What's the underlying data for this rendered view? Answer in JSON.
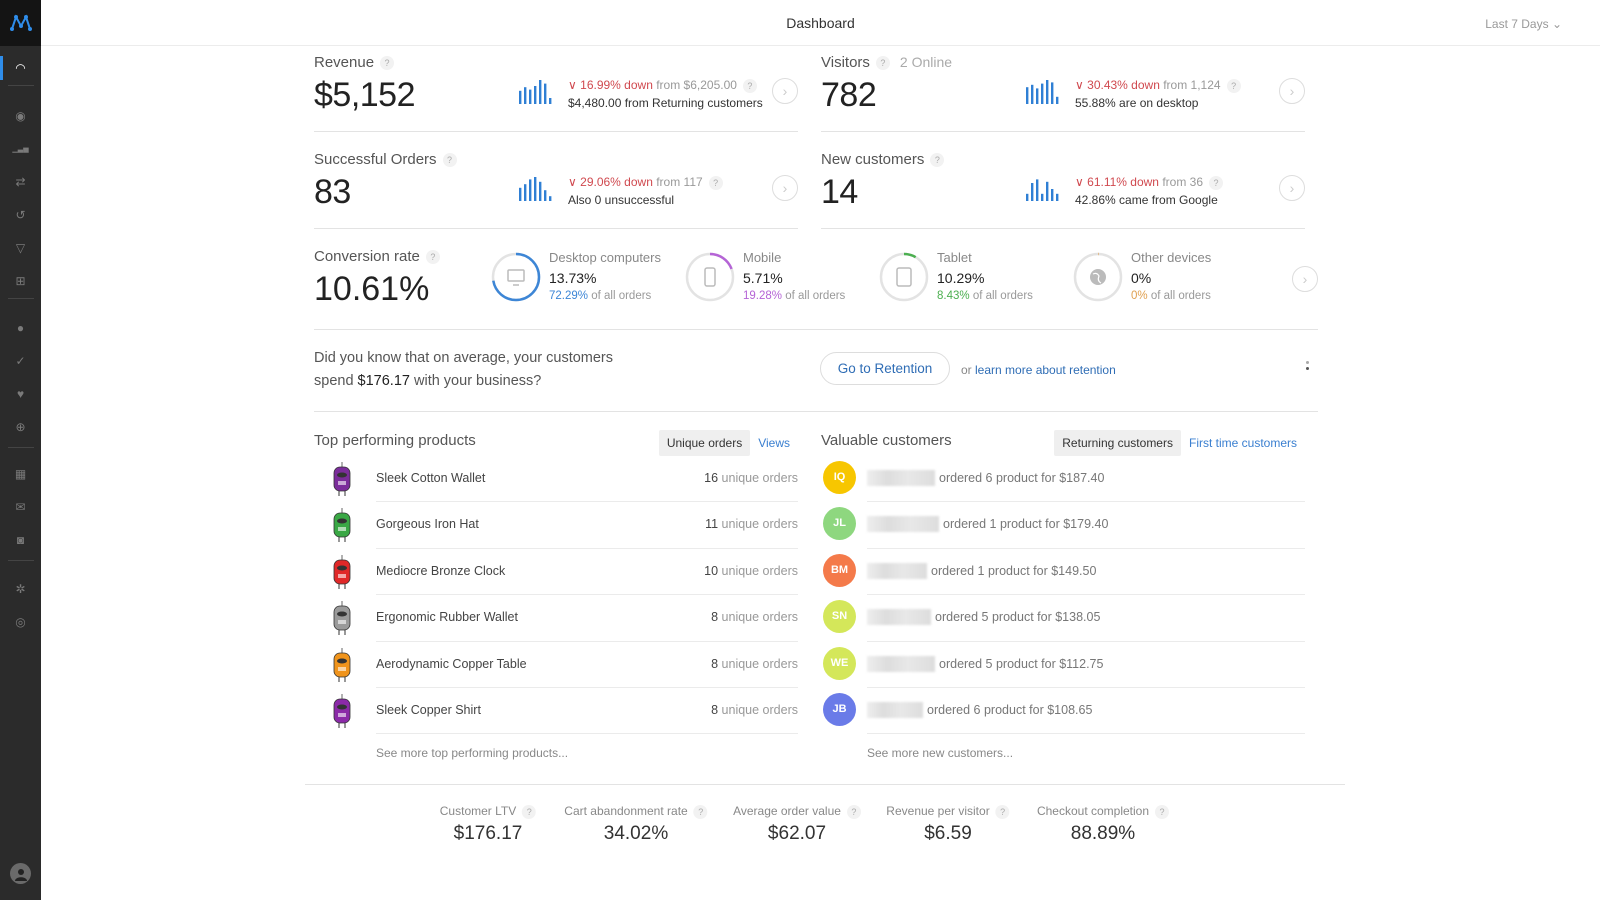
{
  "app": {
    "title": "Dashboard",
    "date_range": "Last 7 Days"
  },
  "sidebar": {
    "items": [
      {
        "name": "dashboard",
        "icon": "speedometer-icon",
        "active": true
      },
      {
        "name": "visitors",
        "icon": "eye-icon"
      },
      {
        "name": "analytics",
        "icon": "bar-chart-icon"
      },
      {
        "name": "flows",
        "icon": "shuffle-icon"
      },
      {
        "name": "history",
        "icon": "history-icon"
      },
      {
        "name": "funnels",
        "icon": "funnel-icon"
      },
      {
        "name": "ecommerce",
        "icon": "cart-icon"
      },
      {
        "name": "people",
        "icon": "person-icon"
      },
      {
        "name": "goals",
        "icon": "check-icon"
      },
      {
        "name": "feedback",
        "icon": "heart-message-icon"
      },
      {
        "name": "support",
        "icon": "lifebuoy-icon"
      },
      {
        "name": "layouts",
        "icon": "layout-icon"
      },
      {
        "name": "email",
        "icon": "envelope-icon"
      },
      {
        "name": "bots",
        "icon": "robot-icon"
      },
      {
        "name": "settings",
        "icon": "gear-icon"
      },
      {
        "name": "integrations",
        "icon": "globe-icon"
      }
    ]
  },
  "kpis": {
    "revenue": {
      "label": "Revenue",
      "value": "$5,152",
      "change": "16.99% down",
      "from": "from $6,205.00",
      "sub": "$4,480.00 from Returning customers",
      "trend": [
        0.55,
        0.7,
        0.6,
        0.75,
        1.0,
        0.85,
        0.25
      ]
    },
    "visitors": {
      "label": "Visitors",
      "online": "2 Online",
      "value": "782",
      "change": "30.43% down",
      "from": "from 1,124",
      "sub": "55.88% are on desktop",
      "trend": [
        0.7,
        0.8,
        0.65,
        0.85,
        1.0,
        0.9,
        0.3
      ]
    },
    "orders": {
      "label": "Successful Orders",
      "value": "83",
      "change": "29.06% down",
      "from": "from 117",
      "sub": "Also 0 unsuccessful",
      "trend": [
        0.55,
        0.7,
        0.9,
        1.0,
        0.8,
        0.45,
        0.2
      ]
    },
    "new_customers": {
      "label": "New customers",
      "value": "14",
      "change": "61.11% down",
      "from": "from 36",
      "sub": "42.86% came from Google",
      "trend": [
        0.3,
        0.75,
        0.9,
        0.3,
        0.8,
        0.5,
        0.3
      ]
    }
  },
  "conversion": {
    "label": "Conversion rate",
    "value": "10.61%",
    "devices": [
      {
        "name": "Desktop computers",
        "icon": "monitor-icon",
        "rate": "13.73%",
        "share": "72.29%",
        "share_suffix": "of all orders",
        "share_fraction": 0.7229,
        "color": "#3d86d6"
      },
      {
        "name": "Mobile",
        "icon": "phone-icon",
        "rate": "5.71%",
        "share": "19.28%",
        "share_suffix": "of all orders",
        "share_fraction": 0.1928,
        "color": "#b564d6"
      },
      {
        "name": "Tablet",
        "icon": "tablet-icon",
        "rate": "10.29%",
        "share": "8.43%",
        "share_suffix": "of all orders",
        "share_fraction": 0.0843,
        "color": "#4caf50"
      },
      {
        "name": "Other devices",
        "icon": "globe-icon",
        "rate": "0%",
        "share": "0%",
        "share_suffix": "of all orders",
        "share_fraction": 0.0,
        "color": "#e0a050"
      }
    ]
  },
  "tip": {
    "line1": "Did you know that on average, your customers",
    "line2_prefix": "spend ",
    "line2_amount": "$176.17",
    "line2_suffix": " with your business?",
    "button": "Go to Retention",
    "or": "or",
    "link": "learn more about retention"
  },
  "products": {
    "title": "Top performing products",
    "tabs": [
      {
        "label": "Unique orders",
        "active": true
      },
      {
        "label": "Views",
        "active": false
      }
    ],
    "unit": "unique orders",
    "items": [
      {
        "name": "Sleek Cotton Wallet",
        "count": "16",
        "color": "#7b2d9b"
      },
      {
        "name": "Gorgeous Iron Hat",
        "count": "11",
        "color": "#3aa845"
      },
      {
        "name": "Mediocre Bronze Clock",
        "count": "10",
        "color": "#e02828"
      },
      {
        "name": "Ergonomic Rubber Wallet",
        "count": "8",
        "color": "#9a9a9a"
      },
      {
        "name": "Aerodynamic Copper Table",
        "count": "8",
        "color": "#f0941c"
      },
      {
        "name": "Sleek Copper Shirt",
        "count": "8",
        "color": "#8b2aa8"
      }
    ],
    "see_more": "See more top performing products..."
  },
  "customers": {
    "title": "Valuable customers",
    "tabs": [
      {
        "label": "Returning customers",
        "active": true
      },
      {
        "label": "First time customers",
        "active": false
      }
    ],
    "items": [
      {
        "initials": "IQ",
        "color": "#f7c600",
        "text": "ordered 6 product for $187.40"
      },
      {
        "initials": "JL",
        "color": "#8ed77f",
        "text": "ordered 1 product for $179.40"
      },
      {
        "initials": "BM",
        "color": "#f47a4a",
        "text": "ordered 1 product for $149.50"
      },
      {
        "initials": "SN",
        "color": "#d4e75a",
        "text": "ordered 5 product for $138.05"
      },
      {
        "initials": "WE",
        "color": "#d4e75a",
        "text": "ordered 5 product for $112.75"
      },
      {
        "initials": "JB",
        "color": "#6a7be8",
        "text": "ordered 6 product for $108.65"
      }
    ],
    "see_more": "See more new customers..."
  },
  "metrics": [
    {
      "label": "Customer LTV",
      "value": "$176.17"
    },
    {
      "label": "Cart abandonment rate",
      "value": "34.02%"
    },
    {
      "label": "Average order value",
      "value": "$62.07"
    },
    {
      "label": "Revenue per visitor",
      "value": "$6.59"
    },
    {
      "label": "Checkout completion",
      "value": "88.89%"
    }
  ]
}
